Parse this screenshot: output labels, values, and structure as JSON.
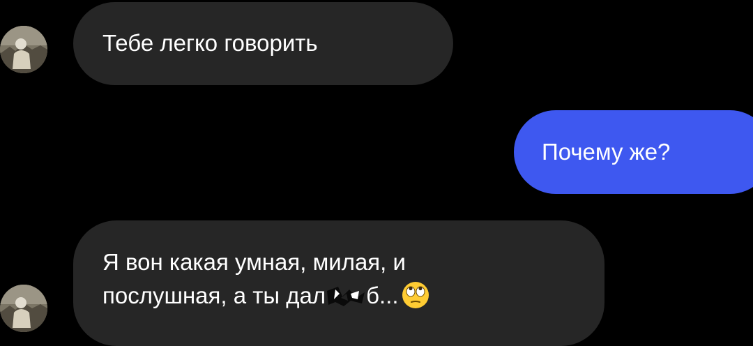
{
  "conversation": {
    "messages": [
      {
        "sender": "other",
        "text": "Тебе легко говорить"
      },
      {
        "sender": "me",
        "text": "Почему же?"
      },
      {
        "sender": "other",
        "lines": [
          "Я вон какая умная, милая, и",
          "послушная, а ты дал"
        ],
        "tail": "б..."
      }
    ],
    "emoji": "face-with-rolling-eyes-emoji",
    "censor": "censored-fragment",
    "colors": {
      "background": "#000000",
      "incoming_bubble": "#262626",
      "outgoing_bubble": "#3e58f0",
      "text": "#ffffff"
    }
  }
}
